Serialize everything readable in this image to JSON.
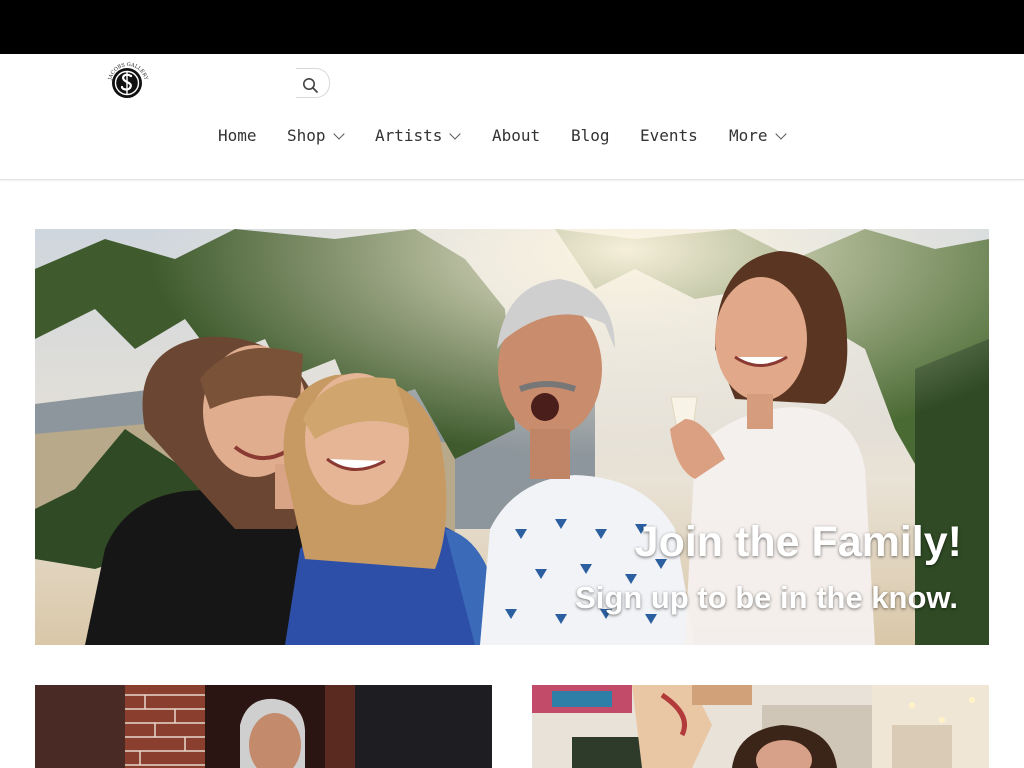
{
  "announcement_bar": {
    "background": "#000000"
  },
  "header": {
    "logo": {
      "alt": "Jacobs Gallery Shop logo",
      "ring_text_top": "JACOBS GALLERY",
      "ring_text_bottom": "SHOP"
    },
    "search": {
      "icon": "search-icon"
    }
  },
  "nav": {
    "items": [
      {
        "label": "Home",
        "has_dropdown": false
      },
      {
        "label": "Shop",
        "has_dropdown": true
      },
      {
        "label": "Artists",
        "has_dropdown": true
      },
      {
        "label": "About",
        "has_dropdown": false
      },
      {
        "label": "Blog",
        "has_dropdown": false
      },
      {
        "label": "Events",
        "has_dropdown": false
      },
      {
        "label": "More",
        "has_dropdown": true
      }
    ],
    "dropdown_icon": "chevron-down-icon"
  },
  "hero": {
    "headline": "Join the Family!",
    "subline": "Sign up to be in the know."
  },
  "cards": [
    {
      "name": "artist-card-left",
      "subject": "man in front of brick wall"
    },
    {
      "name": "artist-card-right",
      "subject": "woman in art studio"
    }
  ]
}
